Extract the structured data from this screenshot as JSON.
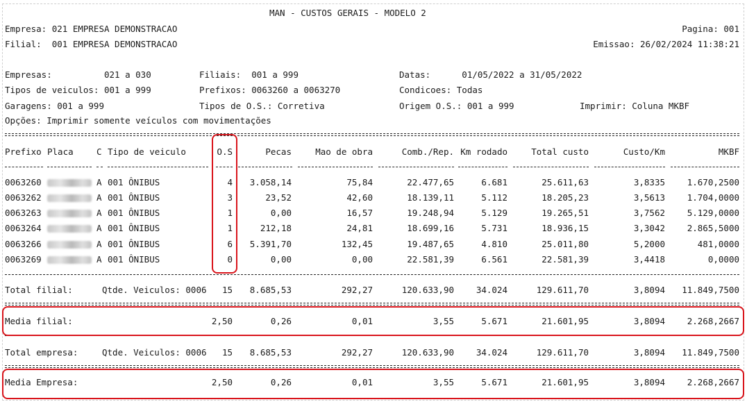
{
  "header": {
    "title": "MAN - CUSTOS GERAIS - MODELO 2",
    "empresa": "Empresa: 021 EMPRESA DEMONSTRACAO",
    "filial": "Filial:  001 EMPRESA DEMONSTRACAO",
    "pagina": "Pagina: 001",
    "emissao": "Emissao: 26/02/2024 11:38:21"
  },
  "filters": {
    "empresas": "Empresas:          021 a 030",
    "filiais": "Filiais:  001 a 999",
    "datas": "Datas:      01/05/2022 a 31/05/2022",
    "tipos_veiculos": "Tipos de veiculos: 001 a 999",
    "prefixos": "Prefixos: 0063260 a 0063270",
    "condicoes": "Condicoes: Todas",
    "garagens": "Garagens: 001 a 999",
    "tipos_os": "Tipos de O.S.: Corretiva",
    "origem_os": "Origem O.S.: 001 a 999",
    "imprimir": "Imprimir: Coluna MKBF",
    "opcoes": "Opções: Imprimir somente veículos com movimentações"
  },
  "columns": {
    "prefixo": "Prefixo",
    "placa": "Placa",
    "c": "C",
    "tipo": "Tipo de veiculo",
    "os": "O.S",
    "pecas": "Pecas",
    "mao": "Mao de obra",
    "comb": "Comb./Rep.",
    "km": "Km rodado",
    "total": "Total custo",
    "custokm": "Custo/Km",
    "mkbf": "MKBF"
  },
  "rows": [
    {
      "prefixo": "0063260",
      "c": "A",
      "tipo": "001 ÔNIBUS",
      "os": "4",
      "pecas": "3.058,14",
      "mao": "75,84",
      "comb": "22.477,65",
      "km": "6.681",
      "total": "25.611,63",
      "custokm": "3,8335",
      "mkbf": "1.670,2500"
    },
    {
      "prefixo": "0063262",
      "c": "A",
      "tipo": "001 ÔNIBUS",
      "os": "3",
      "pecas": "23,52",
      "mao": "42,60",
      "comb": "18.139,11",
      "km": "5.112",
      "total": "18.205,23",
      "custokm": "3,5613",
      "mkbf": "1.704,0000"
    },
    {
      "prefixo": "0063263",
      "c": "A",
      "tipo": "001 ÔNIBUS",
      "os": "1",
      "pecas": "0,00",
      "mao": "16,57",
      "comb": "19.248,94",
      "km": "5.129",
      "total": "19.265,51",
      "custokm": "3,7562",
      "mkbf": "5.129,0000"
    },
    {
      "prefixo": "0063264",
      "c": "A",
      "tipo": "001 ÔNIBUS",
      "os": "1",
      "pecas": "212,18",
      "mao": "24,81",
      "comb": "18.699,16",
      "km": "5.731",
      "total": "18.936,15",
      "custokm": "3,3042",
      "mkbf": "2.865,5000"
    },
    {
      "prefixo": "0063266",
      "c": "A",
      "tipo": "001 ÔNIBUS",
      "os": "6",
      "pecas": "5.391,70",
      "mao": "132,45",
      "comb": "19.487,65",
      "km": "4.810",
      "total": "25.011,80",
      "custokm": "5,2000",
      "mkbf": "481,0000"
    },
    {
      "prefixo": "0063269",
      "c": "A",
      "tipo": "001 ÔNIBUS",
      "os": "0",
      "pecas": "0,00",
      "mao": "0,00",
      "comb": "22.581,39",
      "km": "6.561",
      "total": "22.581,39",
      "custokm": "3,4418",
      "mkbf": "0,0000"
    }
  ],
  "total_filial": {
    "label": "Total filial:",
    "qtde": "Qtde. Veiculos: 0006",
    "os": "15",
    "pecas": "8.685,53",
    "mao": "292,27",
    "comb": "120.633,90",
    "km": "34.024",
    "total": "129.611,70",
    "custokm": "3,8094",
    "mkbf": "11.849,7500"
  },
  "media_filial": {
    "label": "Media filial:",
    "os": "2,50",
    "pecas": "0,26",
    "mao": "0,01",
    "comb": "3,55",
    "km": "5.671",
    "total": "21.601,95",
    "custokm": "3,8094",
    "mkbf": "2.268,2667"
  },
  "total_empresa": {
    "label": "Total empresa:",
    "qtde": "Qtde. Veiculos: 0006",
    "os": "15",
    "pecas": "8.685,53",
    "mao": "292,27",
    "comb": "120.633,90",
    "km": "34.024",
    "total": "129.611,70",
    "custokm": "3,8094",
    "mkbf": "11.849,7500"
  },
  "media_empresa": {
    "label": "Media Empresa:",
    "os": "2,50",
    "pecas": "0,26",
    "mao": "0,01",
    "comb": "3,55",
    "km": "5.671",
    "total": "21.601,95",
    "custokm": "3,8094",
    "mkbf": "2.268,2667"
  },
  "colors": {
    "highlight": "#d9141b",
    "text": "#1a1a1a"
  }
}
